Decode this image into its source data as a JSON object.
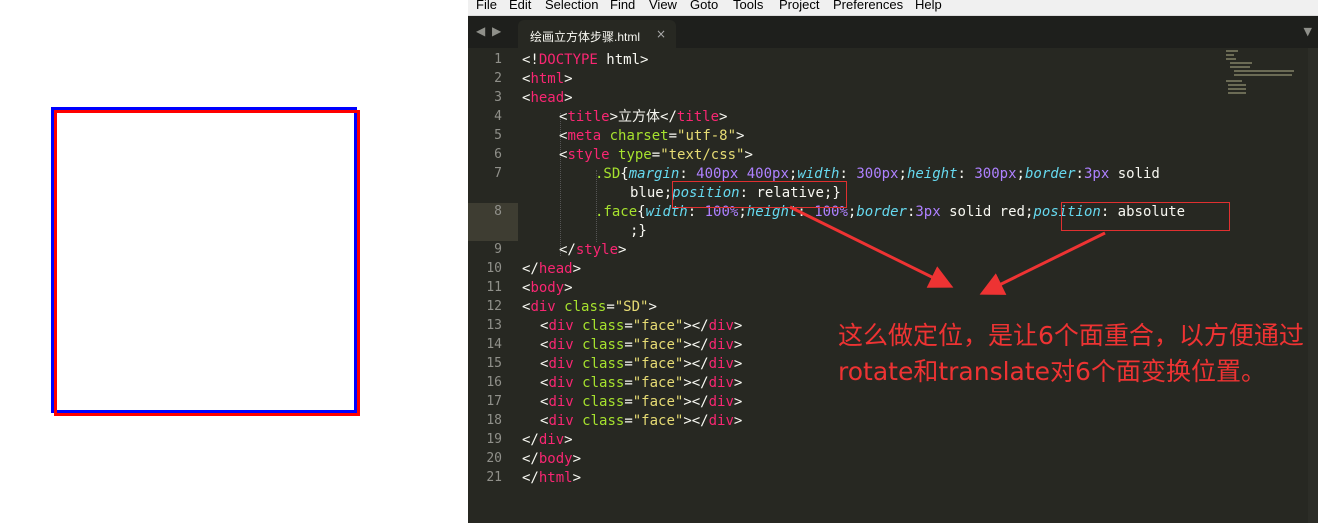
{
  "menu": [
    "File",
    "Edit",
    "Selection",
    "Find",
    "View",
    "Goto",
    "Tools",
    "Project",
    "Preferences",
    "Help"
  ],
  "tab": {
    "label": "绘画立方体步骤.html",
    "close": "×"
  },
  "nav": {
    "back": "◀",
    "forward": "▶",
    "dropdown": "▼"
  },
  "line_numbers": [
    "1",
    "2",
    "3",
    "4",
    "5",
    "6",
    "7",
    "",
    "8",
    "",
    "9",
    "10",
    "11",
    "12",
    "13",
    "14",
    "15",
    "16",
    "17",
    "18",
    "19",
    "20",
    "21"
  ],
  "code": {
    "l1_lt": "<!",
    "l1_doctype": "DOCTYPE",
    "l1_rest": " html>",
    "l2_lt": "<",
    "l2_tag": "html",
    "l2_gt": ">",
    "l3_lt": "<",
    "l3_tag": "head",
    "l3_gt": ">",
    "l4_lt": "<",
    "l4_tag": "title",
    "l4_gt": ">",
    "l4_text": "立方体",
    "l4_close_lt": "</",
    "l4_close_tag": "title",
    "l4_close_gt": ">",
    "l5_lt": "<",
    "l5_tag": "meta",
    "l5_attr": " charset",
    "l5_eq": "=",
    "l5_val": "\"utf-8\"",
    "l5_gt": ">",
    "l6_lt": "<",
    "l6_tag": "style",
    "l6_attr": " type",
    "l6_eq": "=",
    "l6_val": "\"text/css\"",
    "l6_gt": ">",
    "l7_sel": ".SD",
    "l7_brace": "{",
    "l7_p1": "margin",
    "l7_c1": ": ",
    "l7_n1": "400px 400px",
    "l7_s1": ";",
    "l7_p2": "width",
    "l7_c2": ": ",
    "l7_n2": "300px",
    "l7_s2": ";",
    "l7_p3": "height",
    "l7_c3": ": ",
    "l7_n3": "300px",
    "l7_s3": ";",
    "l7_p4": "border",
    "l7_c4": ":",
    "l7_n4": "3px",
    "l7_v4": " solid",
    "l7b_v": "blue;",
    "l7b_p": "position",
    "l7b_c": ": relative;",
    "l7b_end": "}",
    "l8_sel": ".face",
    "l8_brace": "{",
    "l8_p1": "width",
    "l8_c1": ": ",
    "l8_n1": "100%",
    "l8_s1": ";",
    "l8_p2": "height",
    "l8_c2": ": ",
    "l8_n2": "100%",
    "l8_s2": ";",
    "l8_p3": "border",
    "l8_c3": ":",
    "l8_n3": "3px",
    "l8_v3": " solid red;",
    "l8_p4": "position",
    "l8_c4": ": absolute",
    "l8b_end": ";}",
    "l9_lt": "</",
    "l9_tag": "style",
    "l9_gt": ">",
    "l10_lt": "</",
    "l10_tag": "head",
    "l10_gt": ">",
    "l11_lt": "<",
    "l11_tag": "body",
    "l11_gt": ">",
    "l12_lt": "<",
    "l12_tag": "div",
    "l12_attr": " class",
    "l12_eq": "=",
    "l12_val": "\"SD\"",
    "l12_gt": ">",
    "face_lt": "<",
    "face_tag": "div",
    "face_attr": " class",
    "face_eq": "=",
    "face_val": "\"face\"",
    "face_mid": "></",
    "face_close": "div",
    "face_gt": ">",
    "l19_lt": "</",
    "l19_tag": "div",
    "l19_gt": ">",
    "l20_lt": "</",
    "l20_tag": "body",
    "l20_gt": ">",
    "l21_lt": "</",
    "l21_tag": "html",
    "l21_gt": ">"
  },
  "annotation": "这么做定位，是让6个面重合，以方便通过rotate和translate对6个面变换位置。",
  "colors": {
    "annotation": "#ee3333",
    "editor_bg": "#272822",
    "face_border": "#ff0000",
    "sd_border": "#0000ff"
  }
}
